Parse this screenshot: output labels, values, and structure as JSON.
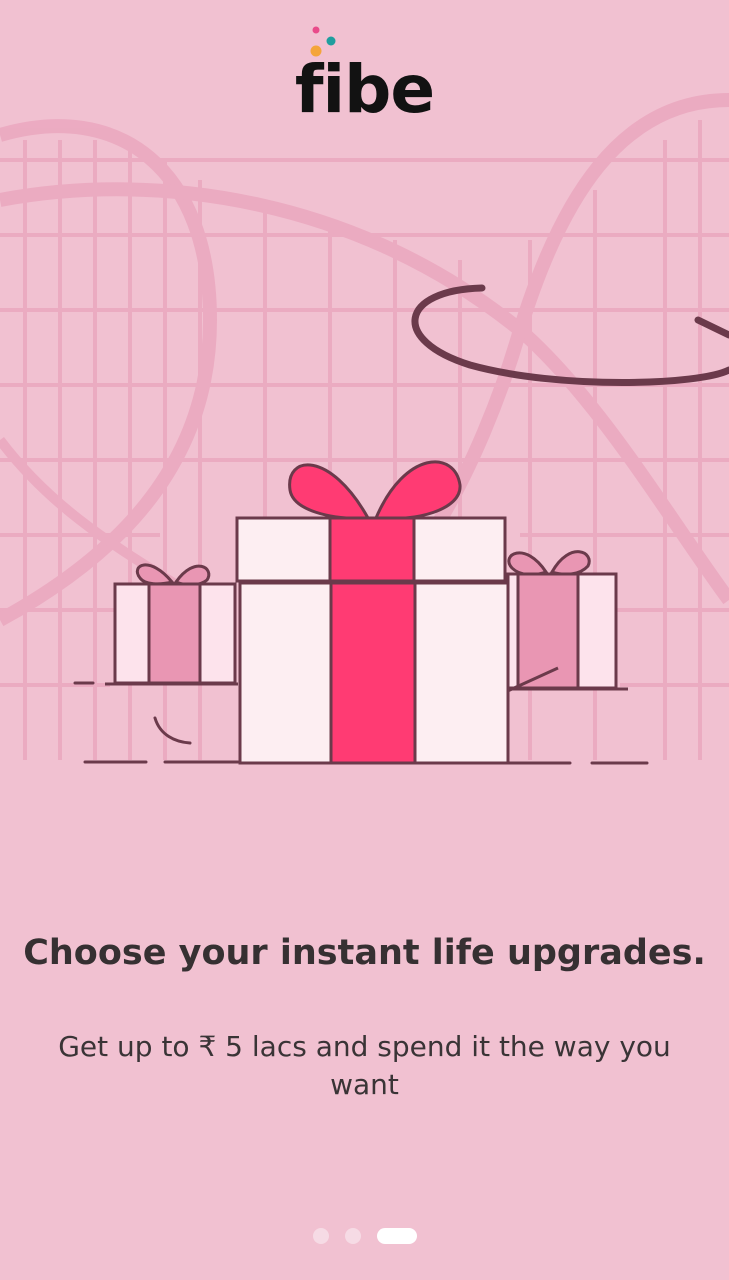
{
  "brand": {
    "name": "fibe",
    "dot_colors": [
      "#e94b8a",
      "#f4a53a",
      "#1f9e9e"
    ]
  },
  "illustration": {
    "subject": "gift-boxes"
  },
  "colors": {
    "background": "#f1c1d1",
    "ribbon": "#ff3b73",
    "box_white": "#fdeef2",
    "box_pink": "#e996b3",
    "outline": "#6b3a4b"
  },
  "onboarding": {
    "headline": "Choose your instant life upgrades.",
    "description": "Get up to ₹ 5 lacs and spend it the way you want"
  },
  "pager": {
    "total": 3,
    "active_index": 2
  }
}
